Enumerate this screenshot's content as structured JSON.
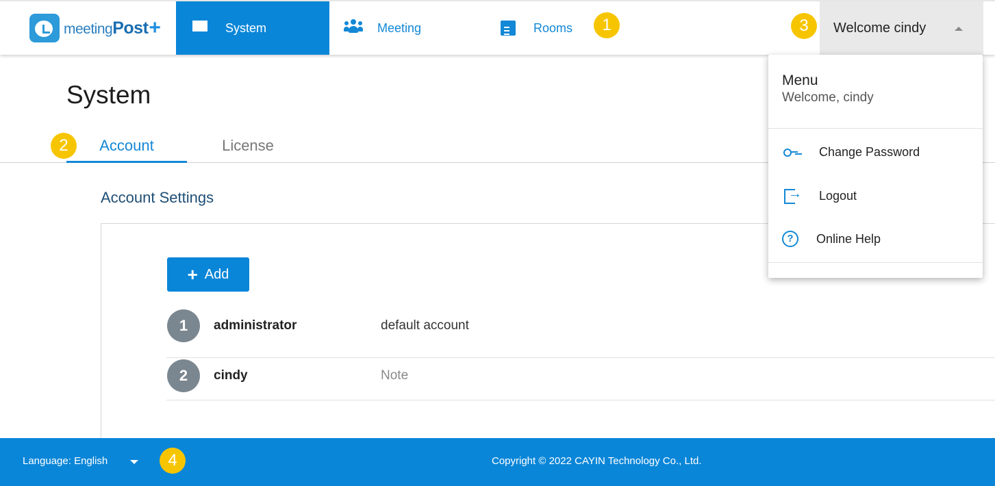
{
  "header": {
    "logo_text": "meeting",
    "logo_text_bold": "Post",
    "logo_plus": "+",
    "nav": [
      {
        "label": "System",
        "icon": "dashboard-grid-icon",
        "active": true
      },
      {
        "label": "Meeting",
        "icon": "people-icon",
        "active": false
      },
      {
        "label": "Rooms",
        "icon": "clipboard-icon",
        "active": false
      }
    ],
    "user_menu_label": "Welcome cindy"
  },
  "badges": [
    "1",
    "2",
    "3",
    "4"
  ],
  "page": {
    "title": "System",
    "tabs": [
      {
        "label": "Account",
        "active": true
      },
      {
        "label": "License",
        "active": false
      }
    ],
    "section_title": "Account Settings",
    "add_button_label": "Add",
    "accounts": [
      {
        "index": "1",
        "name": "administrator",
        "note": "default account"
      },
      {
        "index": "2",
        "name": "cindy",
        "note": "Note"
      }
    ]
  },
  "dropdown": {
    "title": "Menu",
    "subtitle": "Welcome, cindy",
    "items": [
      {
        "label": "Change Password",
        "icon": "key-icon"
      },
      {
        "label": "Logout",
        "icon": "logout-icon"
      },
      {
        "label": "Online Help",
        "icon": "help-circle-icon"
      }
    ]
  },
  "footer": {
    "language_label": "Language: English",
    "copyright": "Copyright © 2022 CAYIN Technology Co., Ltd."
  },
  "colors": {
    "primary": "#0a86d8",
    "badge": "#f7c500",
    "avatar": "#7b8790"
  }
}
